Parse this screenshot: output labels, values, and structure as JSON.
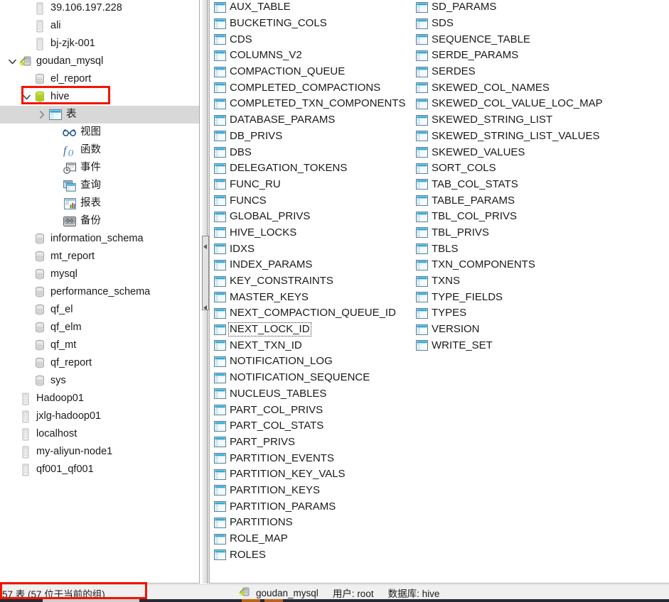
{
  "tree": {
    "nodes": [
      {
        "label": "39.106.197.228",
        "icon": "server-icon",
        "indent": 1,
        "twisty": "",
        "selected": false
      },
      {
        "label": "ali",
        "icon": "server-icon",
        "indent": 1,
        "twisty": "",
        "selected": false
      },
      {
        "label": "bj-zjk-001",
        "icon": "server-icon",
        "indent": 1,
        "twisty": "",
        "selected": false
      },
      {
        "label": "goudan_mysql",
        "icon": "mysql-connection-icon",
        "indent": 0,
        "twisty": "expanded",
        "selected": false
      },
      {
        "label": "el_report",
        "icon": "database-icon",
        "indent": 1,
        "twisty": "",
        "selected": false
      },
      {
        "label": "hive",
        "icon": "database-open-icon",
        "indent": 1,
        "twisty": "expanded",
        "selected": false
      },
      {
        "label": "表",
        "icon": "tables-folder-icon",
        "indent": 2,
        "twisty": "collapsed",
        "selected": true
      },
      {
        "label": "视图",
        "icon": "views-icon",
        "indent": 3,
        "twisty": "",
        "selected": false
      },
      {
        "label": "函数",
        "icon": "functions-icon",
        "indent": 3,
        "twisty": "",
        "selected": false
      },
      {
        "label": "事件",
        "icon": "events-icon",
        "indent": 3,
        "twisty": "",
        "selected": false
      },
      {
        "label": "查询",
        "icon": "queries-icon",
        "indent": 3,
        "twisty": "",
        "selected": false
      },
      {
        "label": "报表",
        "icon": "reports-icon",
        "indent": 3,
        "twisty": "",
        "selected": false
      },
      {
        "label": "备份",
        "icon": "backups-icon",
        "indent": 3,
        "twisty": "",
        "selected": false
      },
      {
        "label": "information_schema",
        "icon": "database-icon",
        "indent": 1,
        "twisty": "",
        "selected": false
      },
      {
        "label": "mt_report",
        "icon": "database-icon",
        "indent": 1,
        "twisty": "",
        "selected": false
      },
      {
        "label": "mysql",
        "icon": "database-icon",
        "indent": 1,
        "twisty": "",
        "selected": false
      },
      {
        "label": "performance_schema",
        "icon": "database-icon",
        "indent": 1,
        "twisty": "",
        "selected": false
      },
      {
        "label": "qf_el",
        "icon": "database-icon",
        "indent": 1,
        "twisty": "",
        "selected": false
      },
      {
        "label": "qf_elm",
        "icon": "database-icon",
        "indent": 1,
        "twisty": "",
        "selected": false
      },
      {
        "label": "qf_mt",
        "icon": "database-icon",
        "indent": 1,
        "twisty": "",
        "selected": false
      },
      {
        "label": "qf_report",
        "icon": "database-icon",
        "indent": 1,
        "twisty": "",
        "selected": false
      },
      {
        "label": "sys",
        "icon": "database-icon",
        "indent": 1,
        "twisty": "",
        "selected": false
      },
      {
        "label": "Hadoop01",
        "icon": "server-icon",
        "indent": 0,
        "twisty": "",
        "selected": false
      },
      {
        "label": "jxlg-hadoop01",
        "icon": "server-icon",
        "indent": 0,
        "twisty": "",
        "selected": false
      },
      {
        "label": "localhost",
        "icon": "server-icon",
        "indent": 0,
        "twisty": "",
        "selected": false
      },
      {
        "label": "my-aliyun-node1",
        "icon": "server-icon",
        "indent": 0,
        "twisty": "",
        "selected": false
      },
      {
        "label": "qf001_qf001",
        "icon": "server-icon",
        "indent": 0,
        "twisty": "",
        "selected": false
      }
    ],
    "highlighted_node": "hive"
  },
  "objects": {
    "column_1": [
      "AUX_TABLE",
      "BUCKETING_COLS",
      "CDS",
      "COLUMNS_V2",
      "COMPACTION_QUEUE",
      "COMPLETED_COMPACTIONS",
      "COMPLETED_TXN_COMPONENTS",
      "DATABASE_PARAMS",
      "DB_PRIVS",
      "DBS",
      "DELEGATION_TOKENS",
      "FUNC_RU",
      "FUNCS",
      "GLOBAL_PRIVS",
      "HIVE_LOCKS",
      "IDXS",
      "INDEX_PARAMS",
      "KEY_CONSTRAINTS",
      "MASTER_KEYS",
      "NEXT_COMPACTION_QUEUE_ID",
      "NEXT_LOCK_ID",
      "NEXT_TXN_ID",
      "NOTIFICATION_LOG",
      "NOTIFICATION_SEQUENCE",
      "NUCLEUS_TABLES",
      "PART_COL_PRIVS",
      "PART_COL_STATS",
      "PART_PRIVS",
      "PARTITION_EVENTS",
      "PARTITION_KEY_VALS",
      "PARTITION_KEYS",
      "PARTITION_PARAMS",
      "PARTITIONS",
      "ROLE_MAP",
      "ROLES"
    ],
    "column_2": [
      "SD_PARAMS",
      "SDS",
      "SEQUENCE_TABLE",
      "SERDE_PARAMS",
      "SERDES",
      "SKEWED_COL_NAMES",
      "SKEWED_COL_VALUE_LOC_MAP",
      "SKEWED_STRING_LIST",
      "SKEWED_STRING_LIST_VALUES",
      "SKEWED_VALUES",
      "SORT_COLS",
      "TAB_COL_STATS",
      "TABLE_PARAMS",
      "TBL_COL_PRIVS",
      "TBL_PRIVS",
      "TBLS",
      "TXN_COMPONENTS",
      "TXNS",
      "TYPE_FIELDS",
      "TYPES",
      "VERSION",
      "WRITE_SET"
    ],
    "focused_item": "NEXT_LOCK_ID"
  },
  "statusbar": {
    "count_text": "57 表 (57 位于当前的组)",
    "connection": "goudan_mysql",
    "user_label": "用户: root",
    "database_label": "数据库: hive"
  },
  "colors": {
    "highlight_red": "#f41200",
    "selection_gray": "#d8d8d8",
    "table_icon_blue": "#35a8d8",
    "db_icon_green": "#b5d334",
    "text": "#1a1a1a"
  }
}
